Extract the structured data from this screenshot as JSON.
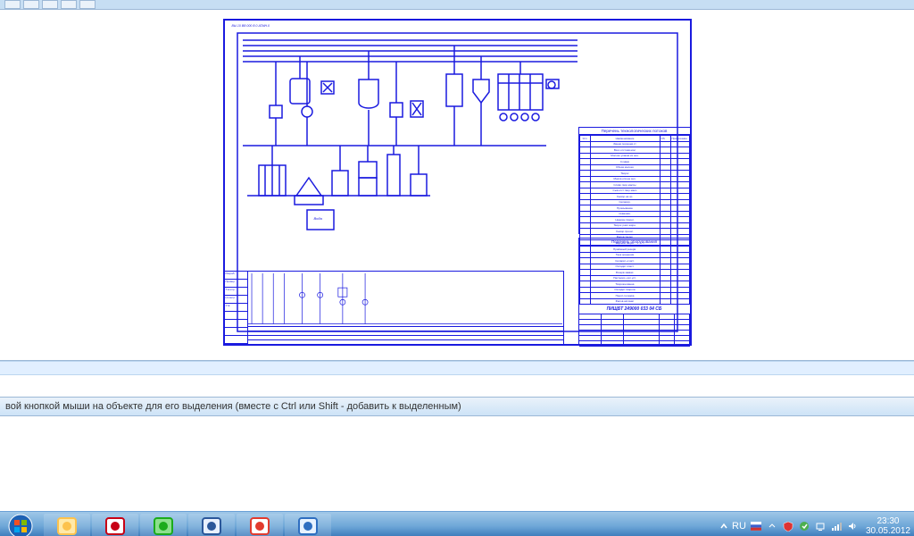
{
  "app": {
    "status_text": "вой кнопкой мыши на объекте для его выделения (вместе с Ctrl или Shift - добавить к выделенным)"
  },
  "drawing": {
    "ruler_label": "ВЫ 10 ВВ 000 В 0 АТМН.0",
    "flows_table": {
      "title": "Перечень технологических потоков",
      "head": [
        "Усл",
        "Наименование",
        "Об.",
        "Примечание"
      ],
      "rows": [
        "Змеев поршнев.ст",
        "Вхоз отстояв.мол",
        "Молоко упаков.из оон.",
        "Сливки",
        "Обезж.молоко",
        "Творог",
        "Масса отв.на сеп.",
        "Сливк.твор.массы",
        "Сыв.отст.твор.масс",
        "Сывор.на хр.",
        "Сепарир.",
        "Промывание",
        "Сквашив.",
        "Нежирн.творог.",
        "Творог разл.жирн.",
        "Сывор.прошл.",
        "Фасов.творог",
        "Формов.творог"
      ]
    },
    "equip_table": {
      "title": "Перечень оборудования",
      "rows": [
        "Приёмный резерв.",
        "Танк хранения",
        "Сепарат.-очист.",
        "Охладит.пласт.",
        "Резерв.заквас.",
        "Пастериз.-охл.уст.",
        "Творожн.ванна",
        "Охладит.творога",
        "Пресс-тележка",
        "Фасов.автомат"
      ]
    },
    "title_block": {
      "code": "ПИЩБТ 249000  033 04 СБ"
    },
    "lower_left": {
      "labels": [
        "Разраб.",
        "Провер.",
        "Т.контр.",
        "Н.контр.",
        "Утв."
      ]
    },
    "tank_label": "Вода"
  },
  "taskbar": {
    "buttons": [
      {
        "name": "explorer-icon",
        "color1": "#ffe9a8",
        "color2": "#fcc24d"
      },
      {
        "name": "opera-classic-icon",
        "color1": "#ffffff",
        "color2": "#c80015"
      },
      {
        "name": "mail-icon",
        "color1": "#8de08d",
        "color2": "#1bab1b"
      },
      {
        "name": "word-icon",
        "color1": "#e8f0ff",
        "color2": "#2b579a"
      },
      {
        "name": "opera-icon",
        "color1": "#ffffff",
        "color2": "#e23b2e"
      },
      {
        "name": "kompas-icon",
        "color1": "#e7f2ff",
        "color2": "#2e6ec0"
      }
    ],
    "lang": "RU",
    "clock": {
      "time": "23:30",
      "date": "30.05.2012"
    }
  }
}
